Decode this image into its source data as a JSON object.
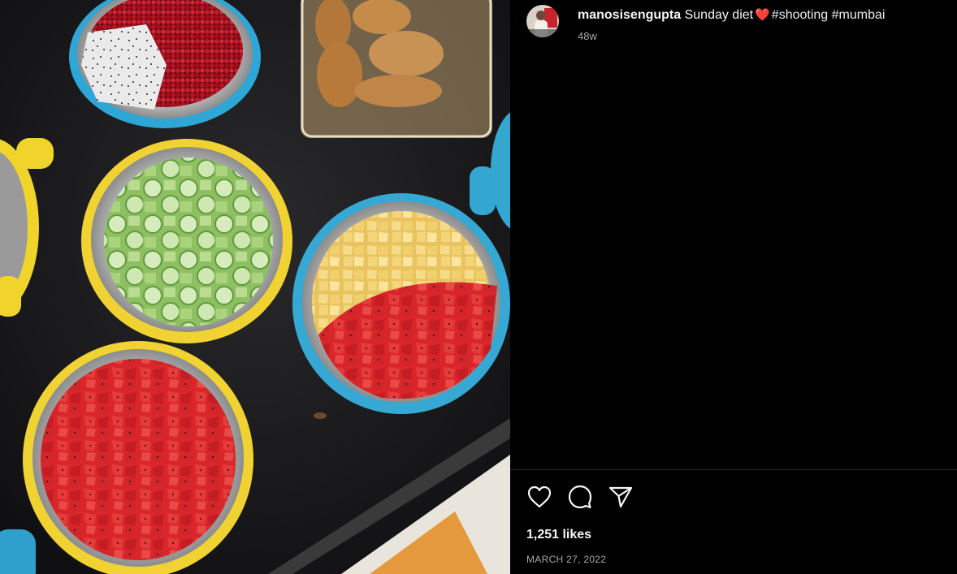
{
  "post": {
    "username": "manosisengupta",
    "caption_text": "Sunday diet",
    "caption_emoji": "❤️",
    "hashtags": [
      "#shooting",
      "#mumbai"
    ],
    "age": "48w",
    "likes": "1,251 likes",
    "date": "MARCH 27, 2022"
  },
  "actions": {
    "like_icon": "heart-outline-icon",
    "comment_icon": "comment-bubble-icon",
    "share_icon": "paper-plane-icon"
  },
  "colors": {
    "background": "#000000",
    "text_primary": "#f5f5f5",
    "text_secondary": "#a8a8a8",
    "divider": "#262626",
    "heart_emoji": "#e0263b"
  },
  "photo": {
    "subject": "fruit-bowls-photo"
  }
}
